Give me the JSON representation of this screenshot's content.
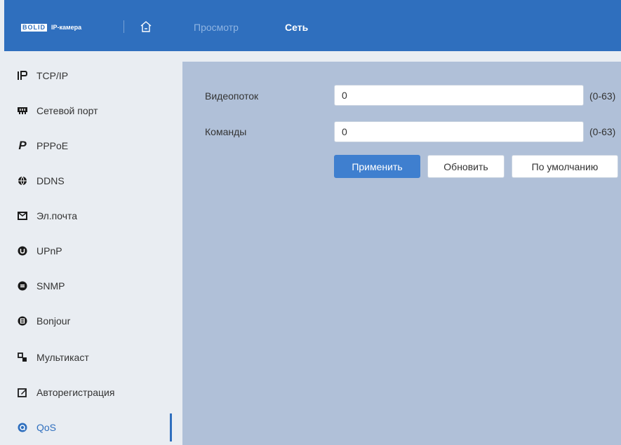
{
  "header": {
    "logo_brand": "BOLID",
    "logo_text": "IP-камера",
    "nav": [
      {
        "label": "Просмотр",
        "active": false
      },
      {
        "label": "Сеть",
        "active": true
      }
    ]
  },
  "sidebar": {
    "items": [
      {
        "label": "TCP/IP",
        "icon": "ip-icon",
        "glyph": "IP"
      },
      {
        "label": "Сетевой порт",
        "icon": "network-port-icon",
        "glyph": "⊟"
      },
      {
        "label": "PPPoE",
        "icon": "pppoe-icon",
        "glyph": "P"
      },
      {
        "label": "DDNS",
        "icon": "ddns-icon",
        "glyph": "⊕"
      },
      {
        "label": "Эл.почта",
        "icon": "mail-icon",
        "glyph": "✉"
      },
      {
        "label": "UPnP",
        "icon": "upnp-icon",
        "glyph": "●"
      },
      {
        "label": "SNMP",
        "icon": "snmp-icon",
        "glyph": "●"
      },
      {
        "label": "Bonjour",
        "icon": "bonjour-icon",
        "glyph": "●"
      },
      {
        "label": "Мультикаст",
        "icon": "multicast-icon",
        "glyph": "⊞"
      },
      {
        "label": "Авторегистрация",
        "icon": "autoregister-icon",
        "glyph": "✎"
      },
      {
        "label": "QoS",
        "icon": "qos-icon",
        "glyph": "◉",
        "active": true
      }
    ]
  },
  "form": {
    "video_label": "Видеопоток",
    "video_value": "0",
    "video_range": "(0-63)",
    "cmd_label": "Команды",
    "cmd_value": "0",
    "cmd_range": "(0-63)",
    "apply_label": "Применить",
    "refresh_label": "Обновить",
    "default_label": "По умолчанию"
  },
  "colors": {
    "header_bg": "#2f6fbe",
    "content_bg": "#b0c0d8",
    "sidebar_bg": "#e9edf2",
    "accent": "#3f7fcf"
  }
}
